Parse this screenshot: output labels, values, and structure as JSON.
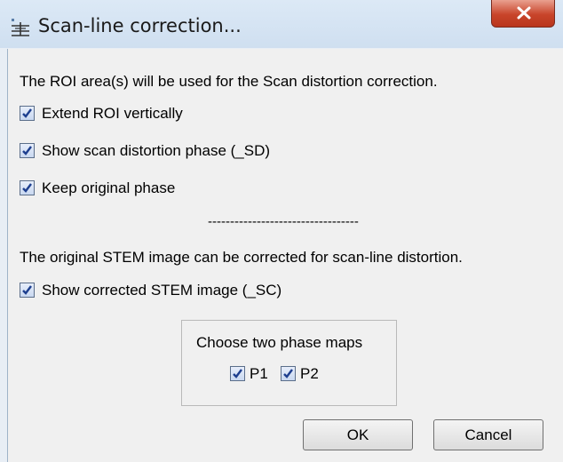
{
  "window": {
    "title": "Scan-line correction...",
    "close_glyph": "X"
  },
  "dialog": {
    "intro": "The ROI area(s) will be used for the Scan distortion correction.",
    "options": [
      {
        "label": "Extend ROI vertically",
        "checked": true
      },
      {
        "label": "Show scan distortion phase (_SD)",
        "checked": true
      },
      {
        "label": "Keep original phase",
        "checked": true
      }
    ],
    "separator": "----------------------------------",
    "stem_text": "The original STEM image can be corrected for scan-line distortion.",
    "stem_option": {
      "label": "Show corrected STEM image (_SC)",
      "checked": true
    },
    "phase_group": {
      "title": "Choose two phase maps",
      "maps": [
        {
          "label": "P1",
          "checked": true
        },
        {
          "label": "P2",
          "checked": true
        }
      ]
    },
    "buttons": {
      "ok": "OK",
      "cancel": "Cancel"
    }
  },
  "colors": {
    "titlebar": "#dce9f6",
    "close_button": "#c8442a",
    "dialog_bg": "#f0f0f0",
    "check_mark": "#1e3f8f"
  },
  "icons": {
    "app": "scan-line-app-icon",
    "close": "close-icon",
    "check": "check-icon"
  }
}
